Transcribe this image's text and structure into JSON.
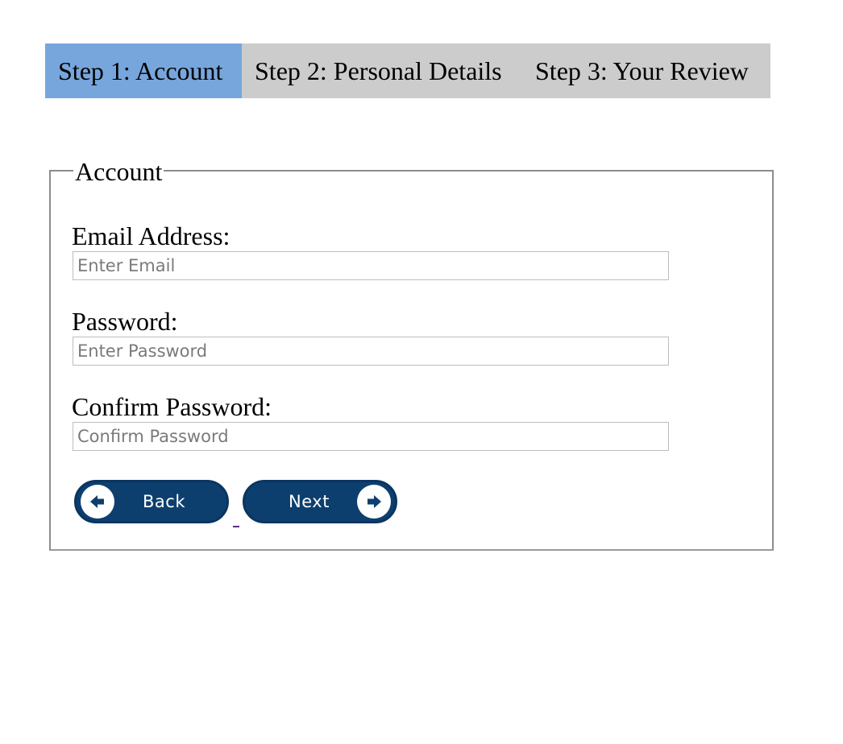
{
  "wizard": {
    "tabs": [
      {
        "label": "Step 1: Account",
        "active": true
      },
      {
        "label": "Step 2: Personal Details",
        "active": false
      },
      {
        "label": "Step 3: Your Review",
        "active": false
      }
    ],
    "active_color": "#77a6dd",
    "inactive_color": "#cccccc"
  },
  "form": {
    "legend": "Account",
    "email": {
      "label": "Email Address:",
      "placeholder": "Enter Email",
      "value": ""
    },
    "password": {
      "label": "Password:",
      "placeholder": "Enter Password",
      "value": ""
    },
    "confirm": {
      "label": "Confirm Password:",
      "placeholder": "Confirm Password",
      "value": ""
    }
  },
  "buttons": {
    "back": {
      "label": "Back",
      "icon": "arrow-left-icon"
    },
    "next": {
      "label": "Next",
      "icon": "arrow-right-icon"
    },
    "color": "#0d3f6e"
  }
}
